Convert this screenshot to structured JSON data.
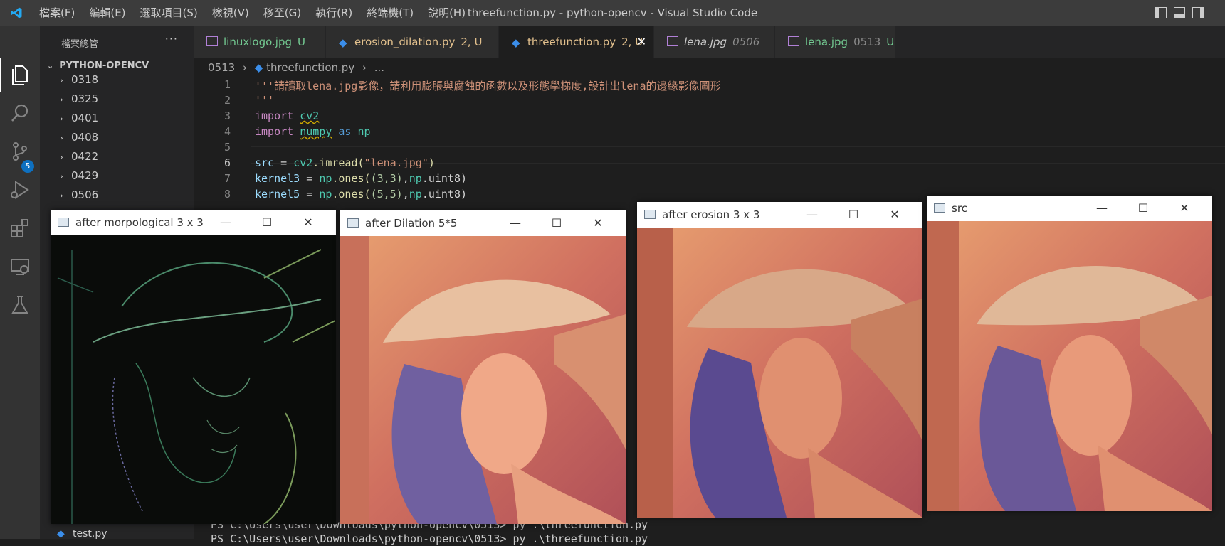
{
  "titlebar": {
    "menu": [
      "檔案(F)",
      "編輯(E)",
      "選取項目(S)",
      "檢視(V)",
      "移至(G)",
      "執行(R)",
      "終端機(T)",
      "說明(H)"
    ],
    "window_title": "threefunction.py - python-opencv - Visual Studio Code"
  },
  "activity_bar": {
    "icons": [
      "explorer-icon",
      "search-icon",
      "source-control-icon",
      "run-debug-icon",
      "extensions-icon",
      "remote-explorer-icon",
      "testing-icon"
    ],
    "scm_badge": "5"
  },
  "sidebar": {
    "title": "檔案總管",
    "more": "···",
    "root": "PYTHON-OPENCV",
    "folders": [
      "0318",
      "0325",
      "0401",
      "0408",
      "0422",
      "0429",
      "0506"
    ],
    "bottom_file": "test.py"
  },
  "tabs": [
    {
      "label": "linuxlogo.jpg",
      "badge": "U",
      "color": "#73c991"
    },
    {
      "label": "erosion_dilation.py",
      "badge": "2, U",
      "color": "#e2c08d"
    },
    {
      "label": "threefunction.py",
      "badge": "2, U",
      "color": "#e2c08d",
      "active": true,
      "close": "✕"
    },
    {
      "label": "lena.jpg",
      "badge": "0506",
      "color": "#cccccc"
    },
    {
      "label": "lena.jpg",
      "badge": "0513",
      "badge2": "U",
      "color": "#73c991"
    }
  ],
  "breadcrumb": {
    "folder": "0513",
    "file": "threefunction.py",
    "rest": "..."
  },
  "editor": {
    "line_numbers": [
      "1",
      "2",
      "3",
      "4",
      "5",
      "6",
      "7",
      "8"
    ],
    "lines": {
      "l1": "'''請讀取lena.jpg影像，請利用膨脹與腐蝕的函數以及形態學梯度,設計出lena的邊緣影像圖形",
      "l2": "'''",
      "l3_kw": "import",
      "l3_mod": "cv2",
      "l4_kw": "import",
      "l4_mod": "numpy",
      "l4_as": "as",
      "l4_alias": "np",
      "l6_var": "src",
      "l6_eq": " = ",
      "l6_mod": "cv2",
      "l6_fn": ".imread(",
      "l6_str": "\"lena.jpg\"",
      "l6_end": ")",
      "l7_var": "kernel3",
      "l7_eq": " = ",
      "l7_mod": "np",
      "l7_fn": ".ones(",
      "l7_args": "(3,3)",
      "l7_sep": ",",
      "l7_mod2": "np",
      "l7_tail": ".uint8)",
      "l8_var": "kernel5",
      "l8_eq": " = ",
      "l8_mod": "np",
      "l8_fn": ".ones(",
      "l8_args": "(5,5)",
      "l8_sep": ",",
      "l8_mod2": "np",
      "l8_tail": ".uint8)"
    }
  },
  "terminal": {
    "line1": "PS C:\\Users\\user\\Downloads\\python-opencv\\0513> py .\\threefunction.py",
    "line2": "PS C:\\Users\\user\\Downloads\\python-opencv\\0513> py .\\threefunction.py"
  },
  "windows": [
    {
      "title": "after morpological 3 x 3",
      "image": "lena-edge-gradient"
    },
    {
      "title": "after Dilation 5*5",
      "image": "lena-dilated"
    },
    {
      "title": "after erosion 3 x 3",
      "image": "lena-eroded"
    },
    {
      "title": "src",
      "image": "lena-original"
    }
  ],
  "window_buttons": {
    "minimize": "—",
    "maximize": "☐",
    "close": "✕"
  }
}
